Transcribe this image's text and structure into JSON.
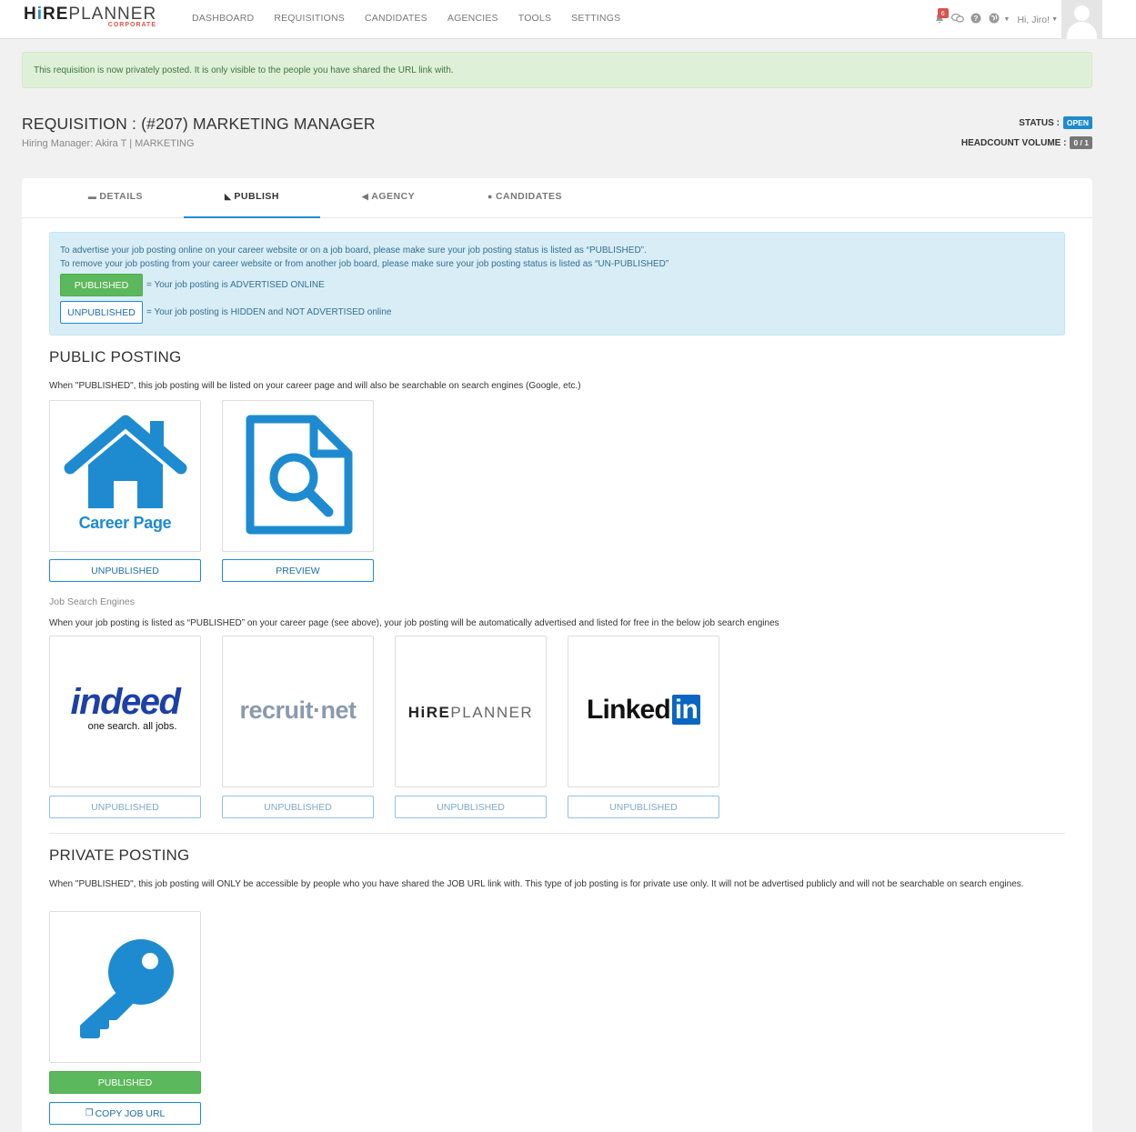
{
  "brand": {
    "name_hi": "H",
    "name_i": "i",
    "name_re": "RE",
    "name_planner": "PLANNER",
    "tag": "CORPORATE"
  },
  "nav": {
    "items": [
      "DASHBOARD",
      "REQUISITIONS",
      "CANDIDATES",
      "AGENCIES",
      "TOOLS",
      "SETTINGS"
    ]
  },
  "user": {
    "notifications": "6",
    "greeting": "Hi, Jiro!"
  },
  "alert": {
    "text": "This requisition is now privately posted. It is only visible to the people you have shared the URL link with."
  },
  "requisition": {
    "title": "REQUISITION : (#207) MARKETING MANAGER",
    "subtitle": "Hiring Manager: Akira T | MARKETING",
    "status_label": "STATUS :",
    "status_value": "OPEN",
    "headcount_label": "HEADCOUNT VOLUME :",
    "headcount_value": "0 / 1"
  },
  "tabs": [
    {
      "label": "DETAILS",
      "icon": "briefcase-icon"
    },
    {
      "label": "PUBLISH",
      "icon": "rss-icon"
    },
    {
      "label": "AGENCY",
      "icon": "bullhorn-icon"
    },
    {
      "label": "CANDIDATES",
      "icon": "user-icon"
    }
  ],
  "info": {
    "line1": "To advertise your job posting online on your career website or on a job board, please make sure your job posting status is listed as “PUBLISHED”.",
    "line2": "To remove your job posting from your career website or from another job board, please make sure your job posting status is listed as “UN-PUBLISHED”",
    "published_label": "PUBLISHED",
    "published_desc": "= Your job posting is ADVERTISED ONLINE",
    "unpublished_label": "UNPUBLISHED",
    "unpublished_desc": "= Your job posting is HIDDEN and NOT ADVERTISED online"
  },
  "public": {
    "title": "PUBLIC POSTING",
    "text": "When \"PUBLISHED\", this job posting will be listed on your career page and will also be searchable on search engines (Google, etc.)",
    "career_label": "Career Page",
    "career_btn": "UNPUBLISHED",
    "preview_btn": "PREVIEW"
  },
  "engines": {
    "label": "Job Search Engines",
    "text": "When your job posting is listed as “PUBLISHED” on your career page (see above), your job posting will be automatically advertised and listed for free in the below job search engines",
    "indeed": {
      "name": "indeed",
      "tagline": "one search. all jobs.",
      "btn": "UNPUBLISHED"
    },
    "recruit": {
      "name": "recruit·net",
      "btn": "UNPUBLISHED"
    },
    "hireplanner": {
      "name_a": "HiRE",
      "name_b": "PLANNER",
      "btn": "UNPUBLISHED"
    },
    "linkedin": {
      "name_a": "Linked",
      "name_b": "in",
      "btn": "UNPUBLISHED"
    }
  },
  "private": {
    "title": "PRIVATE POSTING",
    "text": "When \"PUBLISHED\", this job posting will ONLY be accessible by people who you have shared the JOB URL link with. This type of job posting is for private use only. It will not be advertised publicly and will not be searchable on search engines.",
    "btn": "PUBLISHED",
    "copy_btn": "COPY JOB URL"
  },
  "colors": {
    "accent": "#1e8bd0",
    "success": "#5cb85c",
    "danger": "#d9534f"
  }
}
